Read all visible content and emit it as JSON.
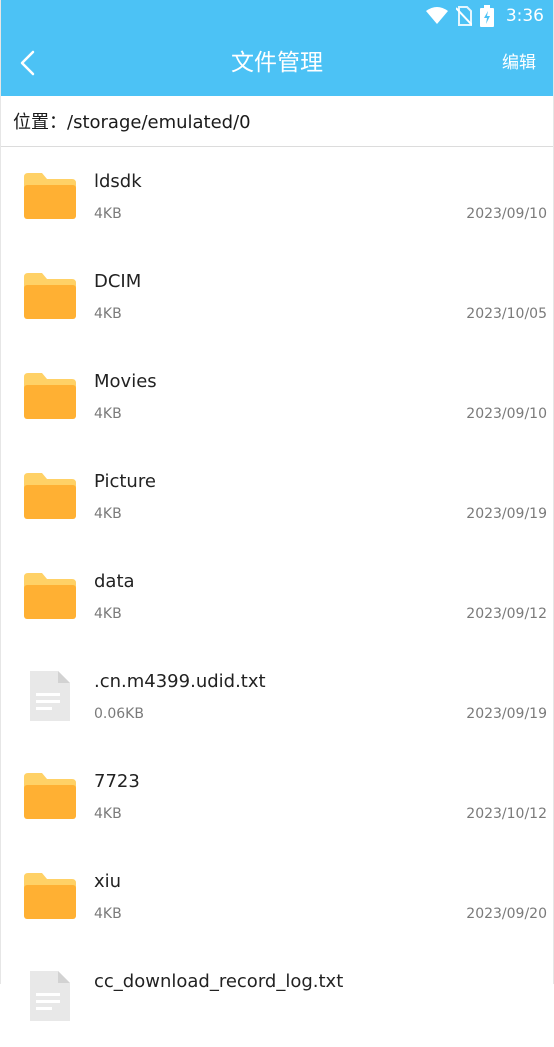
{
  "status": {
    "time": "3:36"
  },
  "header": {
    "title": "文件管理",
    "edit_label": "编辑"
  },
  "path": {
    "text": "位置：/storage/emulated/0"
  },
  "files": [
    {
      "name": "ldsdk",
      "size": "4KB",
      "date": "2023/09/10",
      "type": "folder"
    },
    {
      "name": "DCIM",
      "size": "4KB",
      "date": "2023/10/05",
      "type": "folder"
    },
    {
      "name": "Movies",
      "size": "4KB",
      "date": "2023/09/10",
      "type": "folder"
    },
    {
      "name": "Picture",
      "size": "4KB",
      "date": "2023/09/19",
      "type": "folder"
    },
    {
      "name": "data",
      "size": "4KB",
      "date": "2023/09/12",
      "type": "folder"
    },
    {
      "name": ".cn.m4399.udid.txt",
      "size": "0.06KB",
      "date": "2023/09/19",
      "type": "file"
    },
    {
      "name": "7723",
      "size": "4KB",
      "date": "2023/10/12",
      "type": "folder"
    },
    {
      "name": "xiu",
      "size": "4KB",
      "date": "2023/09/20",
      "type": "folder"
    },
    {
      "name": "cc_download_record_log.txt",
      "size": "",
      "date": "",
      "type": "file"
    }
  ],
  "colors": {
    "accent": "#4cc2f5",
    "folder": "#ffb033",
    "folder_tab": "#ffd166",
    "file": "#e8e8e8"
  }
}
